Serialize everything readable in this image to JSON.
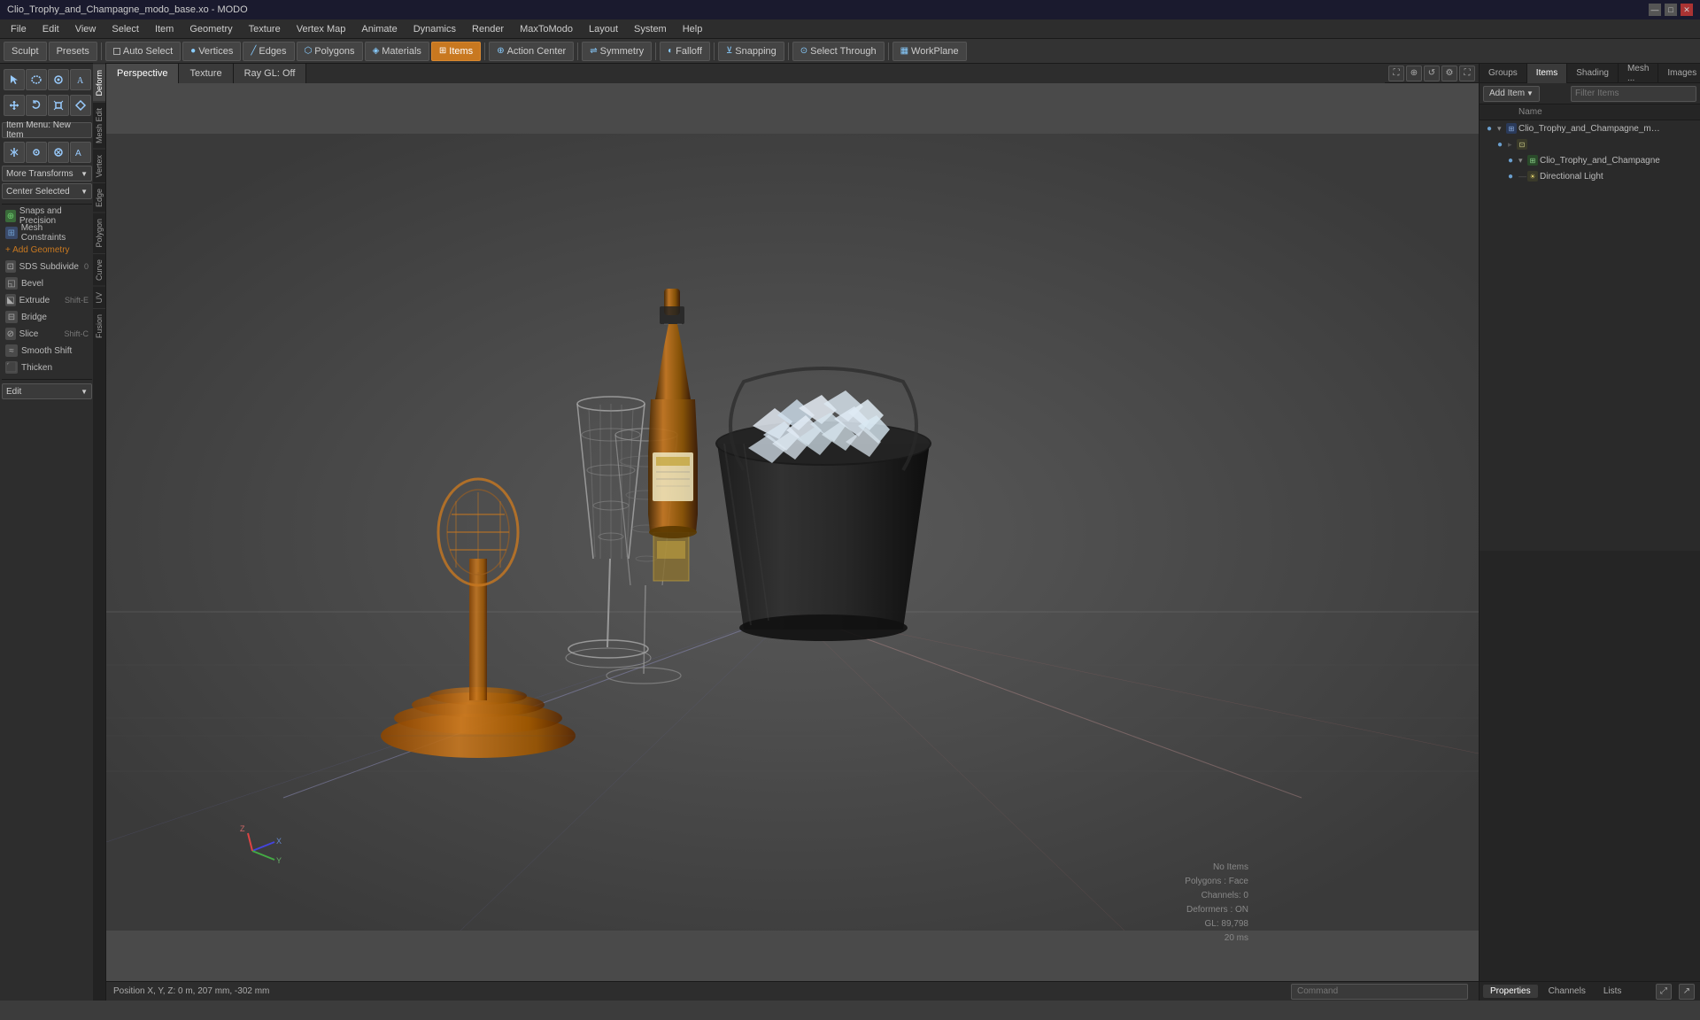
{
  "window": {
    "title": "Clio_Trophy_and_Champagne_modo_base.xo - MODO",
    "win_controls": [
      "—",
      "□",
      "✕"
    ]
  },
  "menu": {
    "items": [
      "File",
      "Edit",
      "View",
      "Select",
      "Item",
      "Geometry",
      "Texture",
      "Vertex Map",
      "Animate",
      "Dynamics",
      "Render",
      "MaxToModo",
      "Layout",
      "System",
      "Help"
    ]
  },
  "toolbar": {
    "sculpt_label": "Sculpt",
    "presets_label": "Presets",
    "auto_select_label": "Auto Select",
    "vertices_label": "Vertices",
    "edges_label": "Edges",
    "polygons_label": "Polygons",
    "materials_label": "Materials",
    "items_label": "Items",
    "action_center_label": "Action Center",
    "symmetry_label": "Symmetry",
    "falloff_label": "Falloff",
    "snapping_label": "Snapping",
    "select_through_label": "Select Through",
    "workplane_label": "WorkPlane"
  },
  "left_panel": {
    "deform_tab": "Deform",
    "mesh_edit_tab": "Mesh Edit",
    "vertex_tab": "Vertex",
    "edge_tab": "Edge",
    "polygon_tab": "Polygon",
    "curve_tab": "Curve",
    "uv_tab": "UV",
    "fusion_tab": "Fusion",
    "item_menu_label": "Item Menu: New Item",
    "more_transforms_label": "More Transforms",
    "center_selected_label": "Center Selected",
    "snaps_precision_label": "Snaps and Precision",
    "mesh_constraints_label": "Mesh Constraints",
    "add_geometry_label": "+ Add Geometry",
    "sds_subdivide_label": "SDS Subdivide",
    "sds_shortcut": "0",
    "bevel_label": "Bevel",
    "extrude_label": "Extrude",
    "extrude_shortcut": "Shift-E",
    "bridge_label": "Bridge",
    "slice_label": "Slice",
    "slice_shortcut": "Shift-C",
    "smooth_shift_label": "Smooth Shift",
    "thicken_label": "Thicken",
    "edit_label": "Edit"
  },
  "viewport": {
    "perspective_tab": "Perspective",
    "texture_tab": "Texture",
    "ray_gl_label": "Ray GL: Off"
  },
  "right_panel": {
    "tabs": [
      "Groups",
      "Items",
      "Shading",
      "Mesh ...",
      "Images"
    ],
    "active_tab": "Items",
    "add_item_label": "Add Item",
    "filter_placeholder": "Filter Items",
    "name_col": "Name",
    "scene_items": [
      {
        "id": "root",
        "name": "Clio_Trophy_and_Champagne_mod...",
        "indent": 0,
        "has_arrow": true,
        "expanded": true,
        "type": "scene"
      },
      {
        "id": "child1",
        "name": "",
        "indent": 1,
        "has_arrow": false,
        "expanded": false,
        "type": "group"
      },
      {
        "id": "mesh1",
        "name": "Clio_Trophy_and_Champagne",
        "indent": 2,
        "has_arrow": true,
        "expanded": false,
        "type": "mesh"
      },
      {
        "id": "light1",
        "name": "Directional Light",
        "indent": 2,
        "has_arrow": false,
        "expanded": false,
        "type": "light"
      }
    ],
    "bottom_tabs": [
      "Properties",
      "Channels",
      "Lists"
    ],
    "active_bottom_tab": "Properties"
  },
  "viewport_info": {
    "no_items": "No Items",
    "polygons_face": "Polygons : Face",
    "channels": "Channels: 0",
    "deformers": "Deformers : ON",
    "gl_stat": "GL: 89,798",
    "time": "20 ms"
  },
  "status_bar": {
    "position_label": "Position X, Y, Z:",
    "position_value": "0 m, 207 mm, -302 mm"
  },
  "command_bar": {
    "placeholder": "Command"
  }
}
